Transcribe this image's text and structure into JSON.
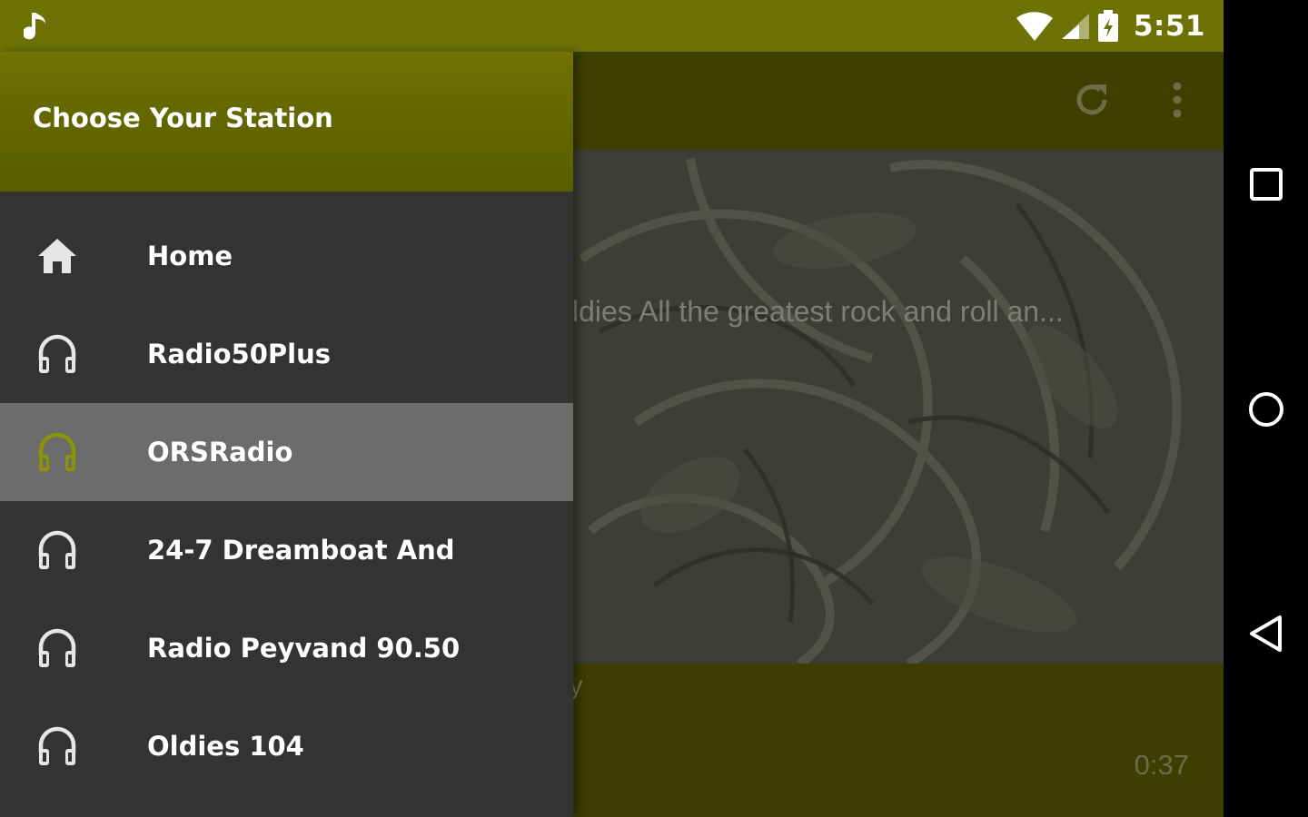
{
  "status_bar": {
    "time": "5:51",
    "icons": [
      "music-note-icon",
      "wifi-icon",
      "cell-signal-icon",
      "battery-icon"
    ]
  },
  "toolbar": {
    "icons": [
      "refresh-icon",
      "more-vert-icon"
    ]
  },
  "player": {
    "now_playing": "ldies All the greatest rock and roll an...",
    "subtitle": "ny",
    "elapsed": "0:37"
  },
  "drawer": {
    "title": "Choose Your Station",
    "items": [
      {
        "label": "Home",
        "icon": "home-icon",
        "selected": false
      },
      {
        "label": "Radio50Plus",
        "icon": "headphones-icon",
        "selected": false
      },
      {
        "label": "ORSRadio",
        "icon": "headphones-icon",
        "selected": true
      },
      {
        "label": "24-7 Dreamboat And",
        "icon": "headphones-icon",
        "selected": false
      },
      {
        "label": "Radio Peyvand 90.50",
        "icon": "headphones-icon",
        "selected": false
      },
      {
        "label": "Oldies 104",
        "icon": "headphones-icon",
        "selected": false
      }
    ]
  },
  "nav_bar": {
    "icons": [
      "recent-apps-icon",
      "home-circle-icon",
      "back-icon"
    ]
  },
  "colors": {
    "accent": "#6e7205",
    "drawer_bg": "#333333",
    "selected_bg": "#6c6c6c",
    "selected_icon": "#8a9407"
  }
}
